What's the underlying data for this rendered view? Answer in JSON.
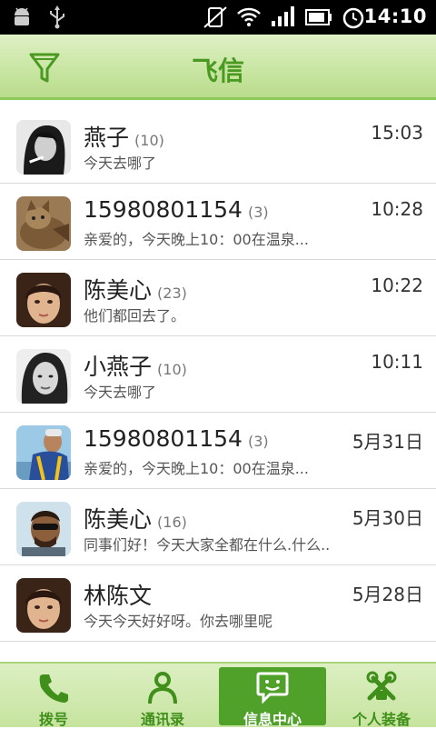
{
  "status_bar": {
    "time": "14:10"
  },
  "header": {
    "title": "飞信"
  },
  "conversations": [
    {
      "name": "燕子",
      "count": "(10)",
      "message": "今天去哪了",
      "time": "15:03",
      "avatar": "avatar-woman-smoking"
    },
    {
      "name": "15980801154",
      "count": "(3)",
      "message": "亲爱的，今天晚上10：00在温泉...",
      "time": "10:28",
      "avatar": "avatar-cat"
    },
    {
      "name": "陈美心",
      "count": "(23)",
      "message": "他们都回去了。",
      "time": "10:22",
      "avatar": "avatar-woman-face"
    },
    {
      "name": "小燕子",
      "count": "(10)",
      "message": "今天去哪了",
      "time": "10:11",
      "avatar": "avatar-woman-bw"
    },
    {
      "name": "15980801154",
      "count": "(3)",
      "message": "亲爱的，今天晚上10：00在温泉...",
      "time": "5月31日",
      "avatar": "avatar-man-lifevest"
    },
    {
      "name": "陈美心",
      "count": "(16)",
      "message": "同事们好！今天大家全都在什么.什么..",
      "time": "5月30日",
      "avatar": "avatar-man-sunglasses"
    },
    {
      "name": "林陈文",
      "count": "",
      "message": "今天今天好好呀。你去哪里呢",
      "time": "5月28日",
      "avatar": "avatar-woman-face"
    }
  ],
  "tabs": [
    {
      "label": "拨号",
      "icon": "phone-icon"
    },
    {
      "label": "通讯录",
      "icon": "contacts-icon"
    },
    {
      "label": "信息中心",
      "icon": "message-icon",
      "active": true
    },
    {
      "label": "个人装备",
      "icon": "tools-icon"
    }
  ],
  "colors": {
    "accent": "#4fa12a",
    "header_title": "#4a9a22"
  }
}
